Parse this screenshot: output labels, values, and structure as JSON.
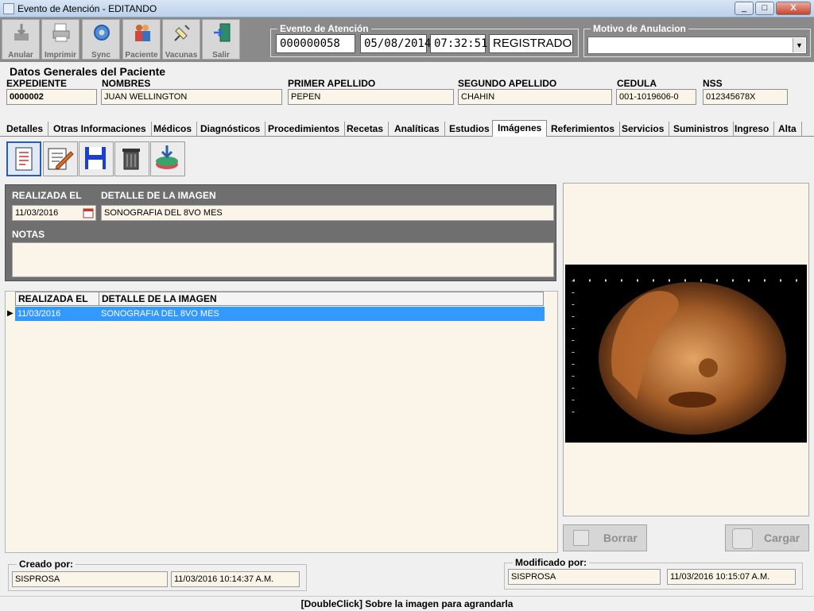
{
  "window": {
    "title": "Evento de Atención - EDITANDO",
    "min": "_",
    "max": "□",
    "close": "X"
  },
  "toolbar": [
    {
      "label": "Anular",
      "icon": "anular-icon"
    },
    {
      "label": "Imprimir",
      "icon": "printer-icon"
    },
    {
      "label": "Sync",
      "icon": "sync-gear-icon"
    },
    {
      "label": "Paciente",
      "icon": "patient-icon"
    },
    {
      "label": "Vacunas",
      "icon": "syringe-icon"
    },
    {
      "label": "Salir",
      "icon": "exit-door-icon"
    }
  ],
  "evento": {
    "legend": "Evento de Atención",
    "numero": "000000058",
    "fecha": "05/08/2014",
    "hora": "07:32:51",
    "estado": "REGISTRADO"
  },
  "anulacion": {
    "legend": "Motivo de Anulacion",
    "value": ""
  },
  "paciente": {
    "legend": "Datos Generales del Paciente",
    "fields": [
      {
        "label": "EXPEDIENTE",
        "value": "0000002"
      },
      {
        "label": "NOMBRES",
        "value": "JUAN WELLINGTON"
      },
      {
        "label": "PRIMER APELLIDO",
        "value": "PEPEN"
      },
      {
        "label": "SEGUNDO APELLIDO",
        "value": "CHAHIN"
      },
      {
        "label": "CEDULA",
        "value": "001-1019606-0"
      },
      {
        "label": "NSS",
        "value": "012345678X"
      }
    ]
  },
  "tabs": [
    "Detalles",
    "Otras Informaciones",
    "Médicos",
    "Diagnósticos",
    "Procedimientos",
    "Recetas",
    "Analíticas",
    "Estudios",
    "Imágenes",
    "Referimientos",
    "Servicios",
    "Suministros",
    "Ingreso",
    "Alta"
  ],
  "active_tab": "Imágenes",
  "imagenes": {
    "realizada_label": "REALIZADA EL",
    "realizada_value": "11/03/2016",
    "detalle_label": "DETALLE DE LA IMAGEN",
    "detalle_value": "SONOGRAFIA DEL 8VO MES",
    "notas_label": "NOTAS",
    "notas_value": "",
    "grid": {
      "headers": [
        "REALIZADA EL",
        "DETALLE DE LA IMAGEN"
      ],
      "rows": [
        [
          "11/03/2016",
          "SONOGRAFIA DEL 8VO MES"
        ]
      ]
    },
    "borrar": "Borrar",
    "cargar": "Cargar"
  },
  "footer": {
    "creado_legend": "Creado por:",
    "creado_user": "SISPROSA",
    "creado_fecha": "11/03/2016 10:14:37 A.M.",
    "modificado_legend": "Modificado por:",
    "modificado_user": "SISPROSA",
    "modificado_fecha": "11/03/2016 10:15:07 A.M."
  },
  "status": "[DoubleClick]  Sobre la imagen para agrandarla"
}
